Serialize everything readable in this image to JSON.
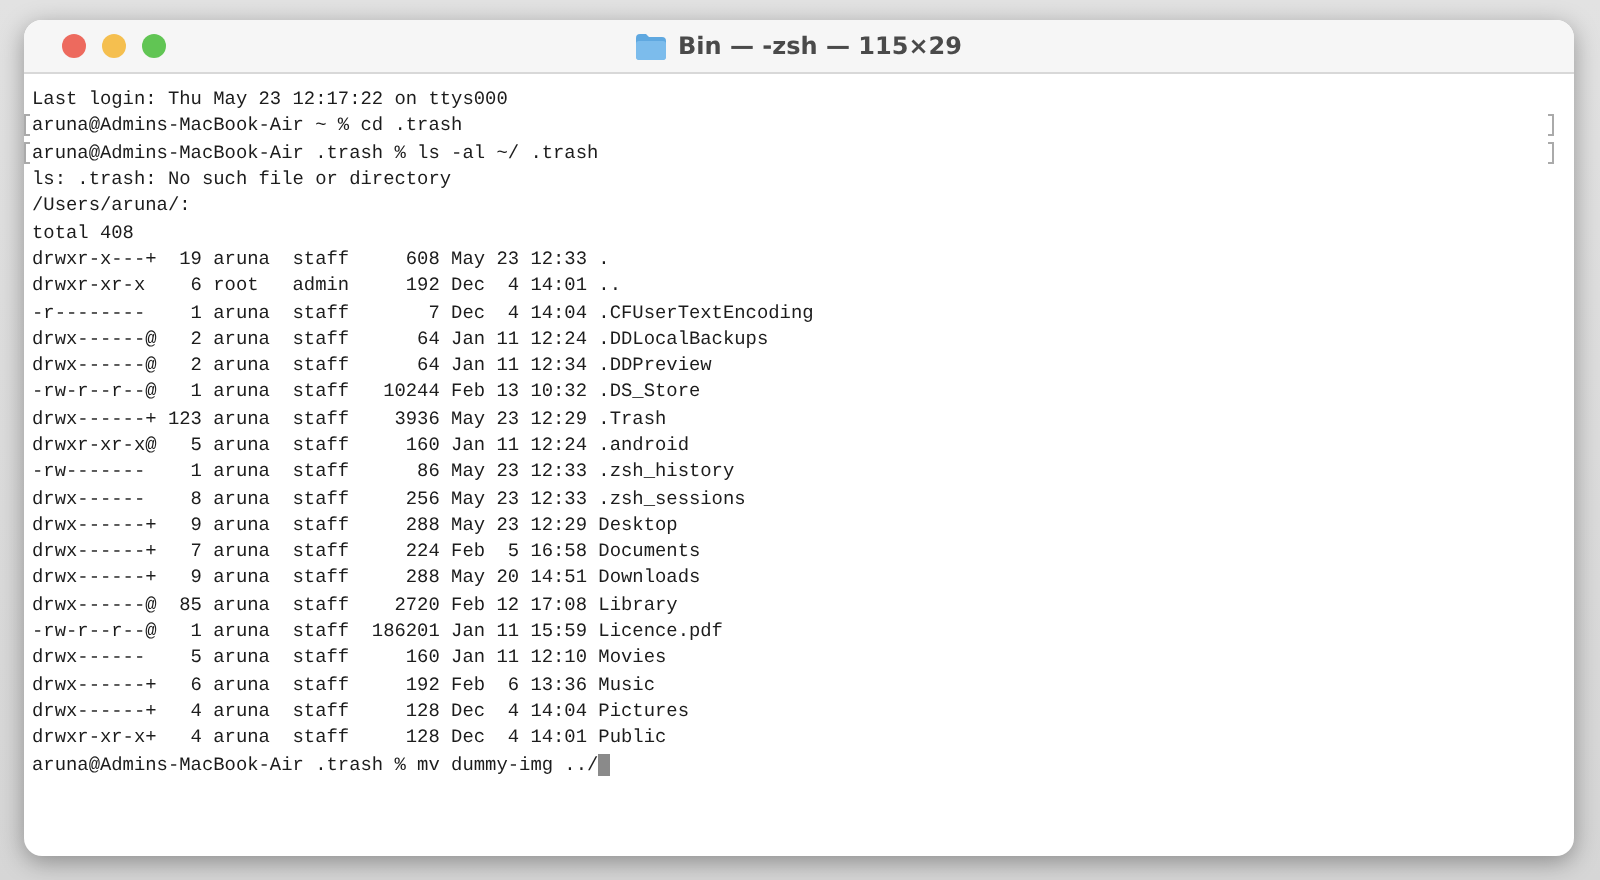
{
  "window": {
    "title": "Bin — -zsh — 115×29"
  },
  "terminal": {
    "lines": [
      {
        "text": "Last login: Thu May 23 12:17:22 on ttys000",
        "marked": false,
        "cursor": false
      },
      {
        "text": "aruna@Admins-MacBook-Air ~ % cd .trash",
        "marked": true,
        "cursor": false
      },
      {
        "text": "aruna@Admins-MacBook-Air .trash % ls -al ~/ .trash",
        "marked": true,
        "cursor": false
      },
      {
        "text": "ls: .trash: No such file or directory",
        "marked": false,
        "cursor": false
      },
      {
        "text": "/Users/aruna/:",
        "marked": false,
        "cursor": false
      },
      {
        "text": "total 408",
        "marked": false,
        "cursor": false
      },
      {
        "text": "drwxr-x---+  19 aruna  staff     608 May 23 12:33 .",
        "marked": false,
        "cursor": false
      },
      {
        "text": "drwxr-xr-x    6 root   admin     192 Dec  4 14:01 ..",
        "marked": false,
        "cursor": false
      },
      {
        "text": "-r--------    1 aruna  staff       7 Dec  4 14:04 .CFUserTextEncoding",
        "marked": false,
        "cursor": false
      },
      {
        "text": "drwx------@   2 aruna  staff      64 Jan 11 12:24 .DDLocalBackups",
        "marked": false,
        "cursor": false
      },
      {
        "text": "drwx------@   2 aruna  staff      64 Jan 11 12:34 .DDPreview",
        "marked": false,
        "cursor": false
      },
      {
        "text": "-rw-r--r--@   1 aruna  staff   10244 Feb 13 10:32 .DS_Store",
        "marked": false,
        "cursor": false
      },
      {
        "text": "drwx------+ 123 aruna  staff    3936 May 23 12:29 .Trash",
        "marked": false,
        "cursor": false
      },
      {
        "text": "drwxr-xr-x@   5 aruna  staff     160 Jan 11 12:24 .android",
        "marked": false,
        "cursor": false
      },
      {
        "text": "-rw-------    1 aruna  staff      86 May 23 12:33 .zsh_history",
        "marked": false,
        "cursor": false
      },
      {
        "text": "drwx------    8 aruna  staff     256 May 23 12:33 .zsh_sessions",
        "marked": false,
        "cursor": false
      },
      {
        "text": "drwx------+   9 aruna  staff     288 May 23 12:29 Desktop",
        "marked": false,
        "cursor": false
      },
      {
        "text": "drwx------+   7 aruna  staff     224 Feb  5 16:58 Documents",
        "marked": false,
        "cursor": false
      },
      {
        "text": "drwx------+   9 aruna  staff     288 May 20 14:51 Downloads",
        "marked": false,
        "cursor": false
      },
      {
        "text": "drwx------@  85 aruna  staff    2720 Feb 12 17:08 Library",
        "marked": false,
        "cursor": false
      },
      {
        "text": "-rw-r--r--@   1 aruna  staff  186201 Jan 11 15:59 Licence.pdf",
        "marked": false,
        "cursor": false
      },
      {
        "text": "drwx------    5 aruna  staff     160 Jan 11 12:10 Movies",
        "marked": false,
        "cursor": false
      },
      {
        "text": "drwx------+   6 aruna  staff     192 Feb  6 13:36 Music",
        "marked": false,
        "cursor": false
      },
      {
        "text": "drwx------+   4 aruna  staff     128 Dec  4 14:04 Pictures",
        "marked": false,
        "cursor": false
      },
      {
        "text": "drwxr-xr-x+   4 aruna  staff     128 Dec  4 14:01 Public",
        "marked": false,
        "cursor": false
      },
      {
        "text": "aruna@Admins-MacBook-Air .trash % mv dummy-img ../",
        "marked": false,
        "cursor": true
      }
    ]
  }
}
